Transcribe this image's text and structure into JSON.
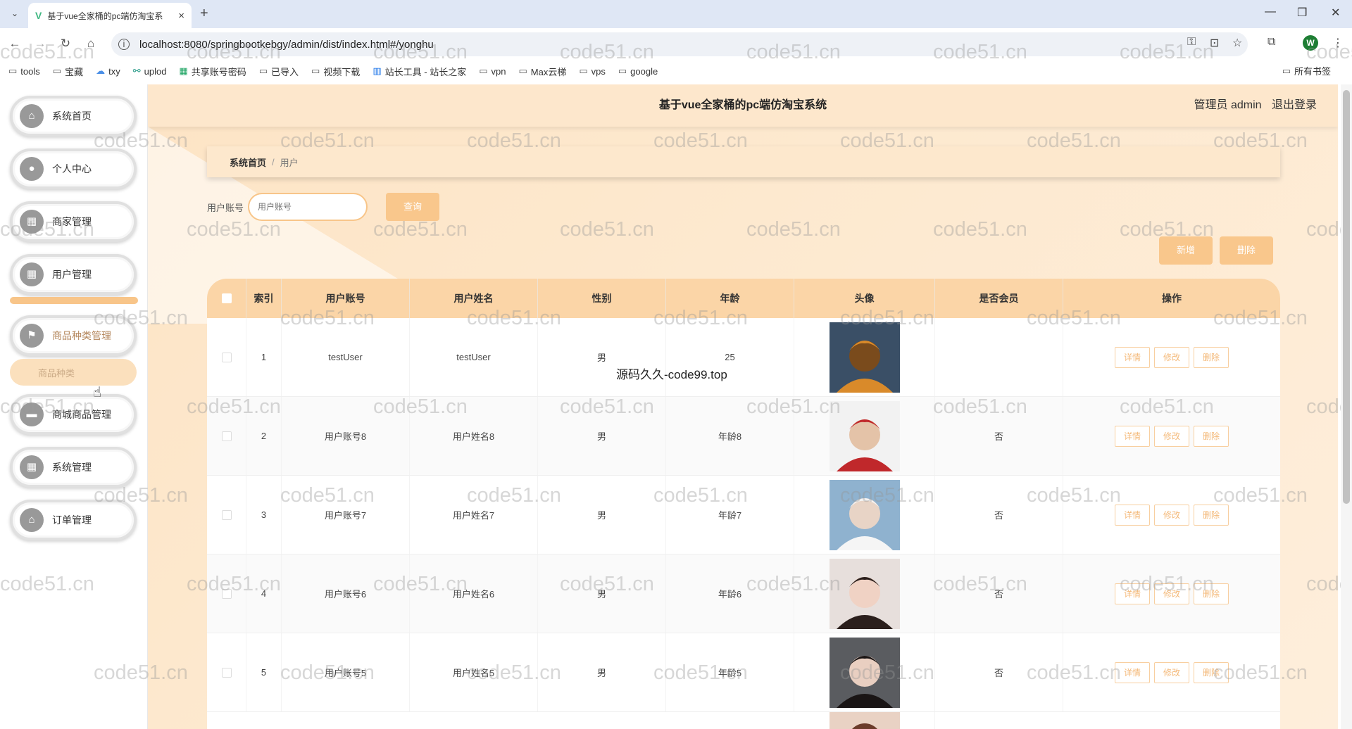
{
  "browser": {
    "tab_title": "基于vue全家桶的pc端仿淘宝系",
    "url": "localhost:8080/springbootkebgy/admin/dist/index.html#/yonghu",
    "profile_initial": "W",
    "bookmarks": [
      "tools",
      "宝藏",
      "txy",
      "uplod",
      "共享账号密码",
      "已导入",
      "视频下载",
      "站长工具 - 站长之家",
      "vpn",
      "Max云梯",
      "vps",
      "google"
    ],
    "all_bookmarks": "所有书签"
  },
  "sidebar": {
    "items": [
      {
        "label": "系统首页",
        "icon": "home-icon"
      },
      {
        "label": "个人中心",
        "icon": "user-icon"
      },
      {
        "label": "商家管理",
        "icon": "grid-icon"
      },
      {
        "label": "用户管理",
        "icon": "grid-icon"
      },
      {
        "label": "商品种类管理",
        "icon": "flag-icon"
      },
      {
        "label": "商城商品管理",
        "icon": "box-icon"
      },
      {
        "label": "系统管理",
        "icon": "grid-icon"
      },
      {
        "label": "订单管理",
        "icon": "store-icon"
      }
    ],
    "submenu_label": "商品种类"
  },
  "header": {
    "title": "基于vue全家桶的pc端仿淘宝系统",
    "role": "管理员 admin",
    "logout": "退出登录"
  },
  "breadcrumb": {
    "home": "系统首页",
    "current": "用户"
  },
  "search": {
    "label": "用户账号",
    "placeholder": "用户账号",
    "button": "查询"
  },
  "actions": {
    "add": "新增",
    "delete": "删除"
  },
  "table": {
    "headers": [
      "索引",
      "用户账号",
      "用户姓名",
      "性别",
      "年龄",
      "头像",
      "是否会员",
      "操作"
    ],
    "rows": [
      {
        "index": "1",
        "account": "testUser",
        "name": "testUser",
        "gender": "男",
        "age": "25",
        "member": ""
      },
      {
        "index": "2",
        "account": "用户账号8",
        "name": "用户姓名8",
        "gender": "男",
        "age": "年龄8",
        "member": "否"
      },
      {
        "index": "3",
        "account": "用户账号7",
        "name": "用户姓名7",
        "gender": "男",
        "age": "年龄7",
        "member": "否"
      },
      {
        "index": "4",
        "account": "用户账号6",
        "name": "用户姓名6",
        "gender": "男",
        "age": "年龄6",
        "member": "否"
      },
      {
        "index": "5",
        "account": "用户账号5",
        "name": "用户姓名5",
        "gender": "男",
        "age": "年龄5",
        "member": "否"
      }
    ],
    "op_buttons": {
      "detail": "详情",
      "edit": "修改",
      "del": "删除"
    }
  },
  "watermark": "code51.cn",
  "overlay_text": "源码久久-code99.top",
  "colors": {
    "accent": "#f9c78c",
    "header_bg": "#fde7cc",
    "table_head": "#fbd5a7"
  }
}
